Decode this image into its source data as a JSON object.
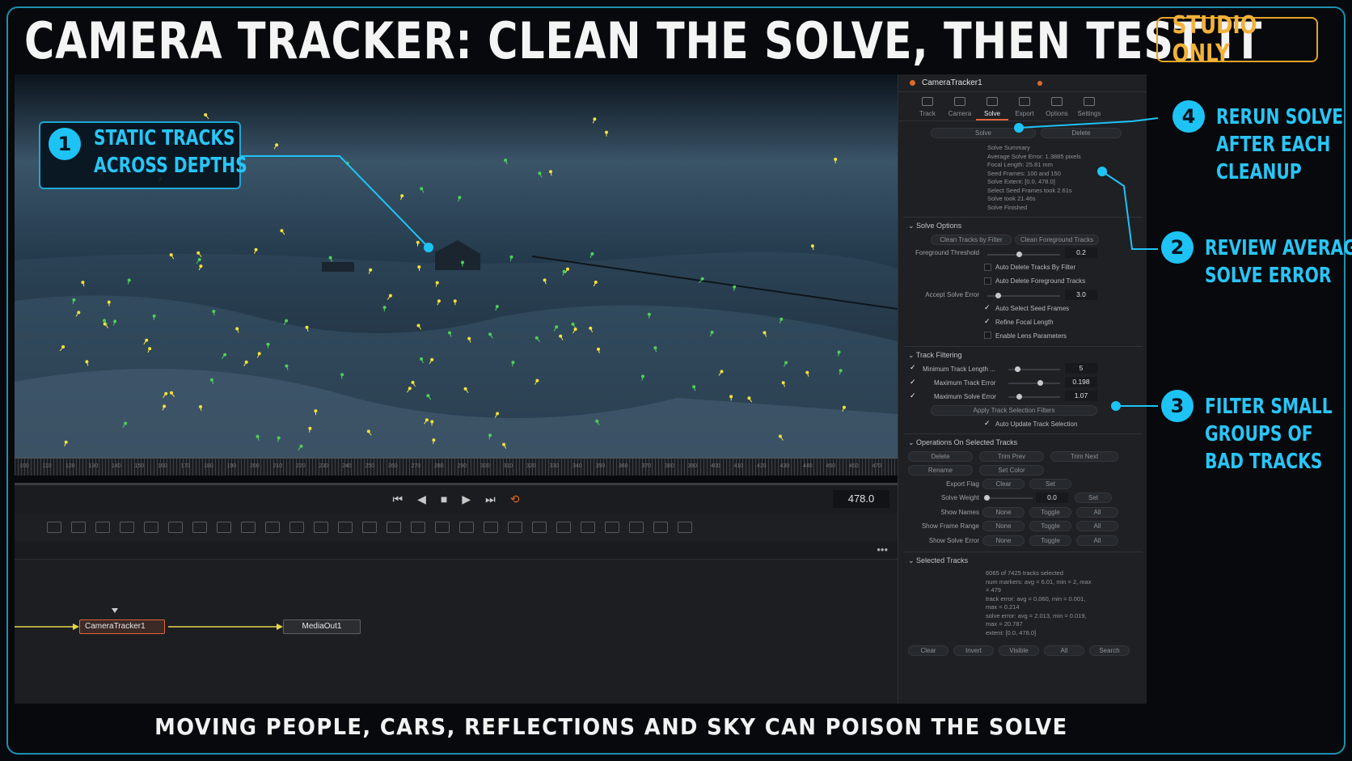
{
  "headline": "CAMERA TRACKER: CLEAN THE SOLVE, THEN TEST IT",
  "badge": "STUDIO ONLY",
  "caption": "MOVING PEOPLE, CARS, REFLECTIONS AND SKY CAN POISON THE SOLVE",
  "annotations": {
    "a1": {
      "num": "1",
      "line1": "STATIC TRACKS",
      "line2": "ACROSS DEPTHS"
    },
    "a2": {
      "num": "2",
      "line1": "REVIEW AVERAGE",
      "line2": "SOLVE ERROR"
    },
    "a3": {
      "num": "3",
      "line1": "FILTER SMALL",
      "line2": "GROUPS OF",
      "line3": "BAD TRACKS"
    },
    "a4": {
      "num": "4",
      "line1": "RERUN SOLVE",
      "line2": "AFTER EACH",
      "line3": "CLEANUP"
    }
  },
  "viewer": {
    "frame": "478.0",
    "ruler_ticks": [
      "100",
      "110",
      "120",
      "130",
      "140",
      "150",
      "160",
      "170",
      "180",
      "190",
      "200",
      "210",
      "220",
      "230",
      "240",
      "250",
      "260",
      "270",
      "280",
      "290",
      "300",
      "310",
      "320",
      "330",
      "340",
      "350",
      "360",
      "370",
      "380",
      "390",
      "400",
      "410",
      "420",
      "430",
      "440",
      "450",
      "460",
      "470"
    ]
  },
  "nodes": {
    "tracker": "CameraTracker1",
    "output": "MediaOut1"
  },
  "inspector": {
    "title": "CameraTracker1",
    "tabs": [
      "Track",
      "Camera",
      "Solve",
      "Export",
      "Options",
      "Settings"
    ],
    "active_tab": "Solve",
    "solve_btn": "Solve",
    "delete_btn": "Delete",
    "summary": [
      "Solve Summary",
      "Average Solve Error: 1.3885 pixels",
      "Focal Length: 25.81 mm",
      "Seed Frames: 100 and 150",
      "Solve Extent: [0.0, 478.0]",
      "Select Seed Frames took 2.61s",
      "Solve took 21.46s",
      "Solve Finished"
    ],
    "solve_options": {
      "title": "Solve Options",
      "clean_filter": "Clean Tracks by Filter",
      "clean_fg": "Clean Foreground Tracks",
      "fg_threshold_label": "Foreground Threshold",
      "fg_threshold": "0.2",
      "auto_delete_filter": "Auto Delete Tracks By Filter",
      "auto_delete_fg": "Auto Delete Foreground Tracks",
      "accept_label": "Accept Solve Error",
      "accept_value": "3.0",
      "auto_seed": "Auto Select Seed Frames",
      "refine_focal": "Refine Focal Length",
      "lens_params": "Enable Lens Parameters"
    },
    "track_filtering": {
      "title": "Track Filtering",
      "min_len_label": "Minimum Track Length ...",
      "min_len": "5",
      "max_track_err_label": "Maximum Track Error",
      "max_track_err": "0.198",
      "max_solve_err_label": "Maximum Solve Error",
      "max_solve_err": "1.07",
      "apply_btn": "Apply Track Selection Filters",
      "auto_update": "Auto Update Track Selection"
    },
    "operations": {
      "title": "Operations On Selected Tracks",
      "delete": "Delete",
      "trim_prev": "Trim Prev",
      "trim_next": "Trim Next",
      "rename": "Rename",
      "set_color": "Set Color",
      "export_flag": "Export Flag",
      "clear": "Clear",
      "set": "Set",
      "solve_weight": "Solve Weight",
      "solve_weight_val": "0.0",
      "set2": "Set",
      "show_names": "Show Names",
      "show_range": "Show Frame Range",
      "show_error": "Show Solve Error",
      "none": "None",
      "toggle": "Toggle",
      "all": "All"
    },
    "selected": {
      "title": "Selected Tracks",
      "lines": [
        "6065 of 7425 tracks selected",
        "num markers: avg = 6.01, min = 2, max",
        "= 479",
        "track error: avg = 0.060, min = 0.001,",
        "max = 0.214",
        "solve error: avg = 2.013, min = 0.019,",
        "max = 20.787",
        "extent: [0.0, 478.0]"
      ],
      "buttons": [
        "Clear",
        "Invert",
        "Visible",
        "All",
        "Search"
      ]
    }
  },
  "colors": {
    "accent": "#1ec3f5",
    "badge": "#f2b23a",
    "track_yellow": "#f5e23a",
    "track_green": "#4fcf5a"
  }
}
